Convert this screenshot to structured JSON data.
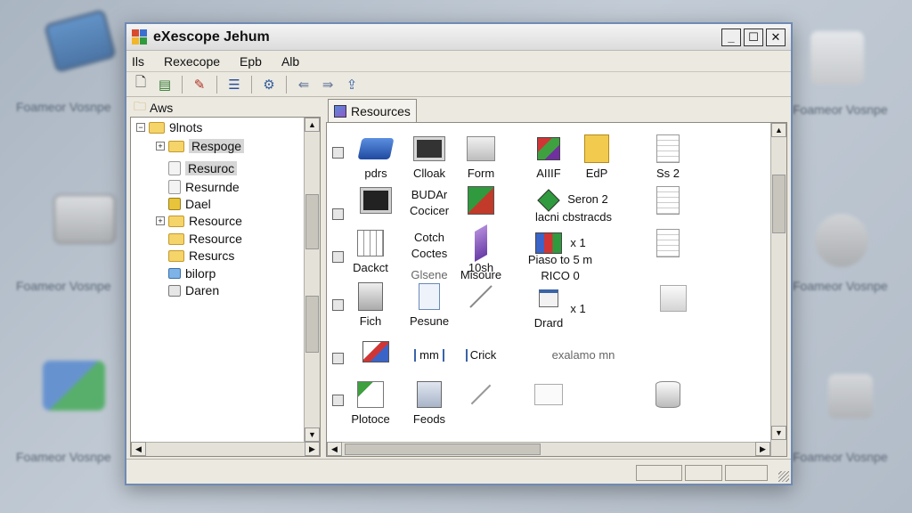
{
  "window": {
    "title": "eXescope Jehum"
  },
  "menu": [
    "Ils",
    "Rexecope",
    "Epb",
    "Alb"
  ],
  "toolbar": [
    "new-doc-icon",
    "save-icon",
    "edit-icon",
    "list-icon",
    "tools-icon",
    "back-icon",
    "forward-icon",
    "export-icon"
  ],
  "left_pane": {
    "header": "Aws",
    "tree": [
      {
        "label": "9lnots",
        "depth": 0
      },
      {
        "label": "Respoge",
        "depth": 1,
        "selected": true
      },
      {
        "label": "Resuroc",
        "depth": 1,
        "selected": true
      },
      {
        "label": "Resurnde",
        "depth": 1
      },
      {
        "label": "Dael",
        "depth": 1
      },
      {
        "label": "Resource",
        "depth": 1
      },
      {
        "label": "Resource",
        "depth": 1
      },
      {
        "label": "Resurcs",
        "depth": 1
      },
      {
        "label": "bilorp",
        "depth": 1
      },
      {
        "label": "Daren",
        "depth": 1
      }
    ]
  },
  "right_pane": {
    "tab": "Resources",
    "labels": {
      "r1": [
        "pdrs",
        "Clloak",
        "Form",
        "AIIIF",
        "EdP",
        "Ss 2"
      ],
      "r2": [
        "BUDAr",
        "Cocicer",
        "Seron 2",
        "lacni cbstracds"
      ],
      "r3": [
        "Dackct",
        "Cotch",
        "Coctes",
        "10sh",
        "x 1",
        "Piaso to 5 m",
        "RICO 0"
      ],
      "r4": [
        "Fich",
        "Glsene",
        "Misoure",
        "Pesune",
        "x 1",
        "Drard"
      ],
      "r5": [
        "mm",
        "Crick",
        "exalamo mn"
      ],
      "r6": [
        "Plotoce",
        "Feods"
      ]
    }
  },
  "desktop": {
    "label": "Foameor Vosnpe"
  }
}
